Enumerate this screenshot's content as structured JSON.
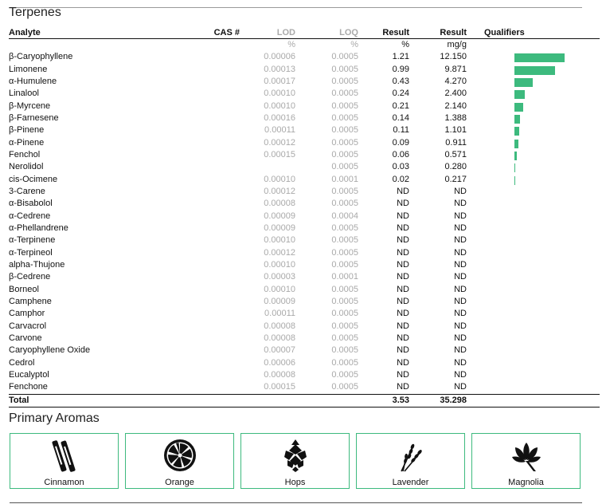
{
  "section_title": "Terpenes",
  "columns": {
    "analyte": "Analyte",
    "cas": "CAS #",
    "lod": "LOD",
    "loq": "LOQ",
    "result_pct": "Result",
    "result_mg": "Result",
    "qualifiers": "Qualifiers"
  },
  "units": {
    "lod": "%",
    "loq": "%",
    "result_pct": "%",
    "result_mg": "mg/g"
  },
  "rows": [
    {
      "analyte": "β-Caryophyllene",
      "lod": "0.00006",
      "loq": "0.0005",
      "pct": "1.21",
      "mg": "12.150",
      "bar": 1.0
    },
    {
      "analyte": "Limonene",
      "lod": "0.00013",
      "loq": "0.0005",
      "pct": "0.99",
      "mg": "9.871",
      "bar": 0.8125
    },
    {
      "analyte": "α-Humulene",
      "lod": "0.00017",
      "loq": "0.0005",
      "pct": "0.43",
      "mg": "4.270",
      "bar": 0.359
    },
    {
      "analyte": "Linalool",
      "lod": "0.00010",
      "loq": "0.0005",
      "pct": "0.24",
      "mg": "2.400",
      "bar": 0.203
    },
    {
      "analyte": "β-Myrcene",
      "lod": "0.00010",
      "loq": "0.0005",
      "pct": "0.21",
      "mg": "2.140",
      "bar": 0.172
    },
    {
      "analyte": "β-Farnesene",
      "lod": "0.00016",
      "loq": "0.0005",
      "pct": "0.14",
      "mg": "1.388",
      "bar": 0.109
    },
    {
      "analyte": "β-Pinene",
      "lod": "0.00011",
      "loq": "0.0005",
      "pct": "0.11",
      "mg": "1.101",
      "bar": 0.094
    },
    {
      "analyte": "α-Pinene",
      "lod": "0.00012",
      "loq": "0.0005",
      "pct": "0.09",
      "mg": "0.911",
      "bar": 0.078
    },
    {
      "analyte": "Fenchol",
      "lod": "0.00015",
      "loq": "0.0005",
      "pct": "0.06",
      "mg": "0.571",
      "bar": 0.047
    },
    {
      "analyte": "Nerolidol",
      "lod": "",
      "loq": "0.0005",
      "pct": "0.03",
      "mg": "0.280",
      "bar": 0.023
    },
    {
      "analyte": "cis-Ocimene",
      "lod": "0.00010",
      "loq": "0.0001",
      "pct": "0.02",
      "mg": "0.217",
      "bar": 0.018
    },
    {
      "analyte": "3-Carene",
      "lod": "0.00012",
      "loq": "0.0005",
      "pct": "ND",
      "mg": "ND",
      "bar": 0
    },
    {
      "analyte": "α-Bisabolol",
      "lod": "0.00008",
      "loq": "0.0005",
      "pct": "ND",
      "mg": "ND",
      "bar": 0
    },
    {
      "analyte": "α-Cedrene",
      "lod": "0.00009",
      "loq": "0.0004",
      "pct": "ND",
      "mg": "ND",
      "bar": 0
    },
    {
      "analyte": "α-Phellandrene",
      "lod": "0.00009",
      "loq": "0.0005",
      "pct": "ND",
      "mg": "ND",
      "bar": 0
    },
    {
      "analyte": "α-Terpinene",
      "lod": "0.00010",
      "loq": "0.0005",
      "pct": "ND",
      "mg": "ND",
      "bar": 0
    },
    {
      "analyte": "α-Terpineol",
      "lod": "0.00012",
      "loq": "0.0005",
      "pct": "ND",
      "mg": "ND",
      "bar": 0
    },
    {
      "analyte": "alpha-Thujone",
      "lod": "0.00010",
      "loq": "0.0005",
      "pct": "ND",
      "mg": "ND",
      "bar": 0
    },
    {
      "analyte": "β-Cedrene",
      "lod": "0.00003",
      "loq": "0.0001",
      "pct": "ND",
      "mg": "ND",
      "bar": 0
    },
    {
      "analyte": "Borneol",
      "lod": "0.00010",
      "loq": "0.0005",
      "pct": "ND",
      "mg": "ND",
      "bar": 0
    },
    {
      "analyte": "Camphene",
      "lod": "0.00009",
      "loq": "0.0005",
      "pct": "ND",
      "mg": "ND",
      "bar": 0
    },
    {
      "analyte": "Camphor",
      "lod": "0.00011",
      "loq": "0.0005",
      "pct": "ND",
      "mg": "ND",
      "bar": 0
    },
    {
      "analyte": "Carvacrol",
      "lod": "0.00008",
      "loq": "0.0005",
      "pct": "ND",
      "mg": "ND",
      "bar": 0
    },
    {
      "analyte": "Carvone",
      "lod": "0.00008",
      "loq": "0.0005",
      "pct": "ND",
      "mg": "ND",
      "bar": 0
    },
    {
      "analyte": "Caryophyllene Oxide",
      "lod": "0.00007",
      "loq": "0.0005",
      "pct": "ND",
      "mg": "ND",
      "bar": 0
    },
    {
      "analyte": "Cedrol",
      "lod": "0.00006",
      "loq": "0.0005",
      "pct": "ND",
      "mg": "ND",
      "bar": 0
    },
    {
      "analyte": "Eucalyptol",
      "lod": "0.00008",
      "loq": "0.0005",
      "pct": "ND",
      "mg": "ND",
      "bar": 0
    },
    {
      "analyte": "Fenchone",
      "lod": "0.00015",
      "loq": "0.0005",
      "pct": "ND",
      "mg": "ND",
      "bar": 0
    }
  ],
  "total": {
    "label": "Total",
    "pct": "3.53",
    "mg": "35.298"
  },
  "bar_color": "#3dba7e",
  "aromas_title": "Primary Aromas",
  "aromas": [
    {
      "label": "Cinnamon",
      "icon": "cinnamon-icon"
    },
    {
      "label": "Orange",
      "icon": "orange-icon"
    },
    {
      "label": "Hops",
      "icon": "hops-icon"
    },
    {
      "label": "Lavender",
      "icon": "lavender-icon"
    },
    {
      "label": "Magnolia",
      "icon": "magnolia-icon"
    }
  ]
}
